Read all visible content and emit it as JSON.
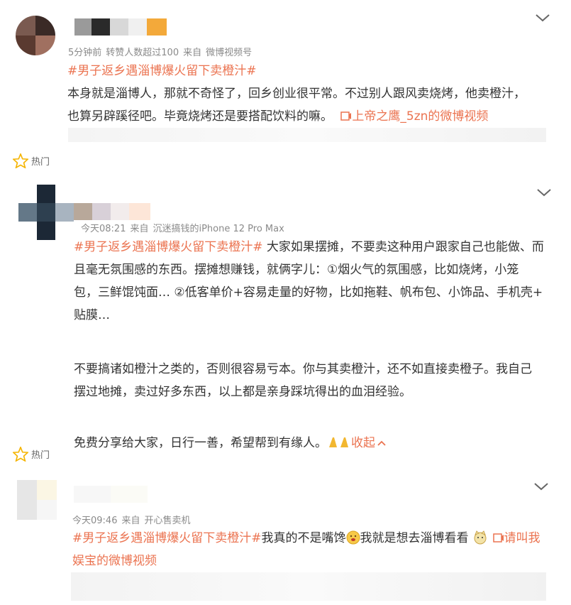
{
  "posts": [
    {
      "meta": {
        "time": "5分钟前",
        "extra": "转赞人数超过100",
        "source_prefix": "来自",
        "source": "微博视频号"
      },
      "tag": "#男子返乡遇淄博爆火留下卖橙汁#",
      "lines": [
        "本身就是淄博人，那就不奇怪了，回乡创业很平常。不过别人跟风卖烧烤，他卖橙汁，",
        "也算另辟蹊径吧。毕竟烧烤还是要搭配饮料的嘛。"
      ],
      "video_link": "上帝之鹰_5zn的微博视频"
    },
    {
      "meta": {
        "time": "今天08:21",
        "source_prefix": "来自",
        "source": "沉迷搞钱的iPhone 12 Pro Max"
      },
      "tag": "#男子返乡遇淄博爆火留下卖橙汁#",
      "lines": [
        " 大家如果摆摊，不要卖这种用户跟家自己也能做、而",
        "且毫无氛围感的东西。摆摊想赚钱，就俩字儿：①烟火气的氛围感，比如烧烤，小笼",
        "包，三鲜馄饨面… ②低客单价+容易走量的好物，比如拖鞋、帆布包、小饰品、手机壳+",
        "贴膜…",
        "",
        "不要搞诸如橙汁之类的，否则很容易亏本。你与其卖橙汁，还不如直接卖橙子。我自己",
        "摆过地摊，卖过好多东西，以上都是亲身踩坑得出的血泪经验。",
        "",
        "免费分享给大家，日行一善，希望帮到有缘人。"
      ],
      "collapse": "收起"
    },
    {
      "meta": {
        "time": "今天09:46",
        "source_prefix": "来自",
        "source": "开心售卖机"
      },
      "tag": "#男子返乡遇淄博爆火留下卖橙汁#",
      "text_a": "我真的不是嘴馋",
      "text_b": "我就是想去淄博看看",
      "video_link_a": "请叫我",
      "video_link_b": "娱宝的微博视频"
    }
  ],
  "hot_label": "热门",
  "colors": {
    "accent": "#eb7350",
    "meta": "#8a8a8a",
    "text": "#333333",
    "star": "#f5b400"
  }
}
